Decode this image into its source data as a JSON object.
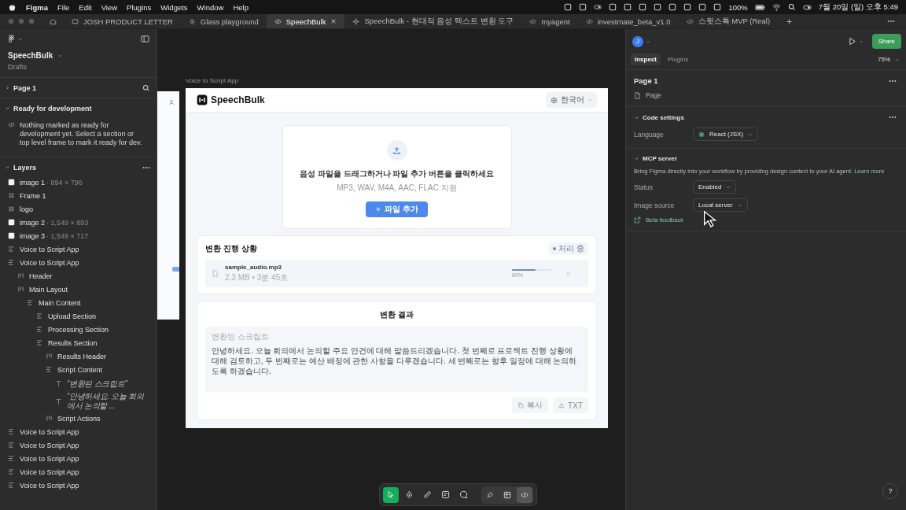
{
  "menubar": {
    "app": "Figma",
    "menus": [
      "File",
      "Edit",
      "View",
      "Plugins",
      "Widgets",
      "Window",
      "Help"
    ],
    "battery": "100%",
    "clock": "7월 20일 (일) 오후 5:49"
  },
  "tabs": [
    {
      "kind": "home",
      "selected": false
    },
    {
      "kind": "slides",
      "label": "JOSH PRODUCT LETTER",
      "selected": false
    },
    {
      "kind": "design",
      "label": "Glass playground",
      "selected": false
    },
    {
      "kind": "dev",
      "label": "SpeechBulk",
      "selected": true
    },
    {
      "kind": "make",
      "label": "SpeechBulk - 현대적 음성 텍스트 변환 도구",
      "selected": false
    },
    {
      "kind": "dev",
      "label": "myagent",
      "selected": false
    },
    {
      "kind": "dev",
      "label": "investmate_beta_v1.0",
      "selected": false
    },
    {
      "kind": "dev",
      "label": "스윗스톡 MVP (Real)",
      "selected": false
    }
  ],
  "left_panel": {
    "file": {
      "name": "SpeechBulk",
      "location": "Drafts"
    },
    "page": {
      "label": "Page 1",
      "expanded": false
    },
    "dev": {
      "title": "Ready for development",
      "expanded": true,
      "message": "Nothing marked as ready for development yet. Select a section or top level frame to mark it ready for dev."
    },
    "layers": {
      "title": "Layers",
      "expanded": true,
      "items": [
        {
          "name": "image 1",
          "detail": "· 894 × 796",
          "kind": "image"
        },
        {
          "name": "Frame 1",
          "kind": "frame"
        },
        {
          "name": "logo",
          "kind": "frame"
        },
        {
          "name": "image 2",
          "detail": "· 1,549 × 893",
          "kind": "image"
        },
        {
          "name": "image 3",
          "detail": "· 1,549 × 717",
          "kind": "image"
        },
        {
          "name": "Voice to Script App",
          "kind": "stack"
        },
        {
          "name": "Voice to Script App",
          "kind": "stack",
          "children": [
            {
              "name": "Header",
              "kind": "row"
            },
            {
              "name": "Main Layout",
              "kind": "row",
              "children": [
                {
                  "name": "Main Content",
                  "kind": "stack",
                  "children": [
                    {
                      "name": "Upload Section",
                      "kind": "stack"
                    },
                    {
                      "name": "Processing Section",
                      "kind": "stack"
                    },
                    {
                      "name": "Results Section",
                      "kind": "stack",
                      "children": [
                        {
                          "name": "Results Header",
                          "kind": "row"
                        },
                        {
                          "name": "Script Content",
                          "kind": "stack",
                          "children": [
                            {
                              "name": "“변환된 스크립트”",
                              "kind": "text"
                            },
                            {
                              "name": "“안녕하세요. 오늘 회의에서 논의할 ...",
                              "kind": "text"
                            }
                          ]
                        },
                        {
                          "name": "Script Actions",
                          "kind": "row"
                        }
                      ]
                    }
                  ]
                }
              ]
            }
          ]
        },
        {
          "name": "Voice to Script App",
          "kind": "stack"
        },
        {
          "name": "Voice to Script App",
          "kind": "stack"
        },
        {
          "name": "Voice to Script App",
          "kind": "stack"
        },
        {
          "name": "Voice to Script App",
          "kind": "stack"
        },
        {
          "name": "Voice to Script App",
          "kind": "stack"
        }
      ]
    }
  },
  "canvas": {
    "frame_label": "Voice to Script App",
    "app": {
      "logo": "SpeechBulk",
      "language": "한국어",
      "upload": {
        "title": "음성 파일을 드래그하거나 파일 추가 버튼을 클릭하세요",
        "formats": "MP3, WAV, M4A, AAC, FLAC 지원",
        "button": "파일 추가"
      },
      "processing": {
        "title": "변환 진행 상황",
        "status": "처리 중",
        "files": [
          {
            "name": "sample_audio.mp3",
            "meta": "2.3 MB • 3분 45초",
            "level": 0.6,
            "percent": "60%"
          }
        ]
      },
      "results": {
        "title": "변환 결과",
        "label": "변환된 스크립트",
        "text": "안녕하세요. 오늘 회의에서 논의할 주요 안건에 대해 말씀드리겠습니다. 첫 번째로 프로젝트 진행 상황에 대해 검토하고, 두 번째로는 예산 배정에 관한 사항을 다루겠습니다. 세 번째로는 향후 일정에 대해 논의하도록 하겠습니다.",
        "actions": [
          {
            "label": "복사",
            "kind": "copy"
          },
          {
            "label": "TXT",
            "kind": "download"
          }
        ]
      }
    }
  },
  "toolbar": {
    "tools": [
      {
        "kind": "move",
        "selected": true
      },
      {
        "kind": "pen",
        "selected": false
      },
      {
        "kind": "measure",
        "selected": false
      },
      {
        "kind": "annotate",
        "selected": false
      },
      {
        "kind": "comment",
        "selected": false
      }
    ],
    "modes": [
      {
        "kind": "design",
        "selected": false
      },
      {
        "kind": "inspect",
        "selected": false
      },
      {
        "kind": "code",
        "selected": true
      }
    ]
  },
  "right_panel": {
    "avatar": "J",
    "share": "Share",
    "tabs": [
      {
        "label": "Inspect",
        "selected": true
      },
      {
        "label": "Plugins",
        "selected": false
      }
    ],
    "zoom": "75%",
    "page_section": {
      "title": "Page 1",
      "type": "Page"
    },
    "code_settings": {
      "title": "Code settings",
      "expanded": true,
      "language_label": "Language",
      "language": "React (JSX)"
    },
    "mcp": {
      "title": "MCP server",
      "expanded": true,
      "description": "Bring Figma directly into your workflow by providing design context to your AI agent.",
      "link": "Learn more",
      "fields": [
        {
          "label": "Status",
          "value": "Enabled"
        },
        {
          "label": "Image source",
          "value": "Local server"
        }
      ],
      "feedback": "Beta feedback"
    },
    "help": "?"
  }
}
